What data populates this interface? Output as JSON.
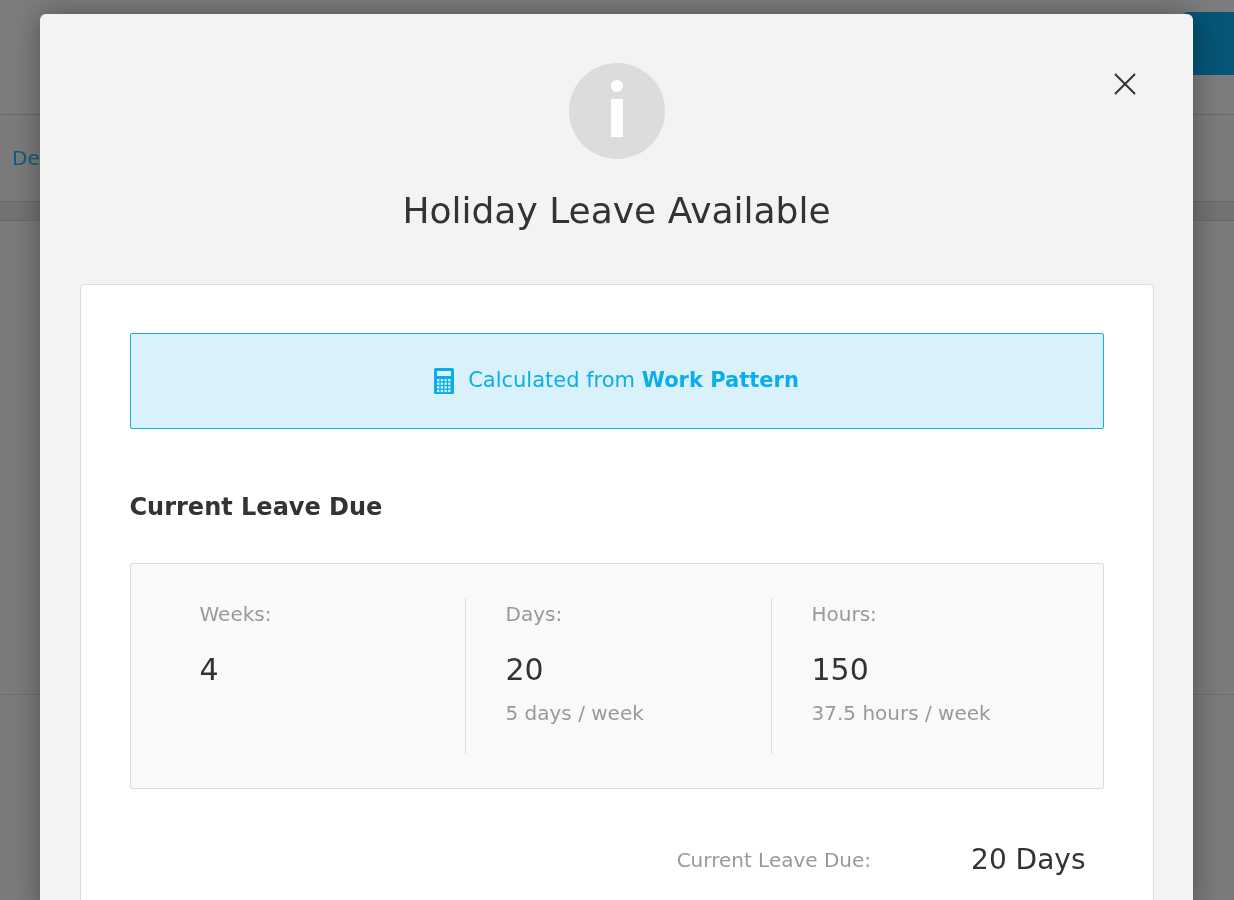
{
  "background_page": {
    "tab_label": "De"
  },
  "dialog": {
    "title": "Holiday Leave Available",
    "banner": "Calculated from **Work Pattern**",
    "section_title": "Current Leave Due",
    "stats": [
      {
        "label": "Weeks:",
        "value": "4"
      },
      {
        "label": "Days:",
        "value": "20",
        "note": "5 days / week"
      },
      {
        "label": "Hours:",
        "value": "150",
        "note": "37.5 hours / week"
      }
    ],
    "summary": {
      "label": "Current Leave Due:",
      "value": "20 Days"
    }
  }
}
